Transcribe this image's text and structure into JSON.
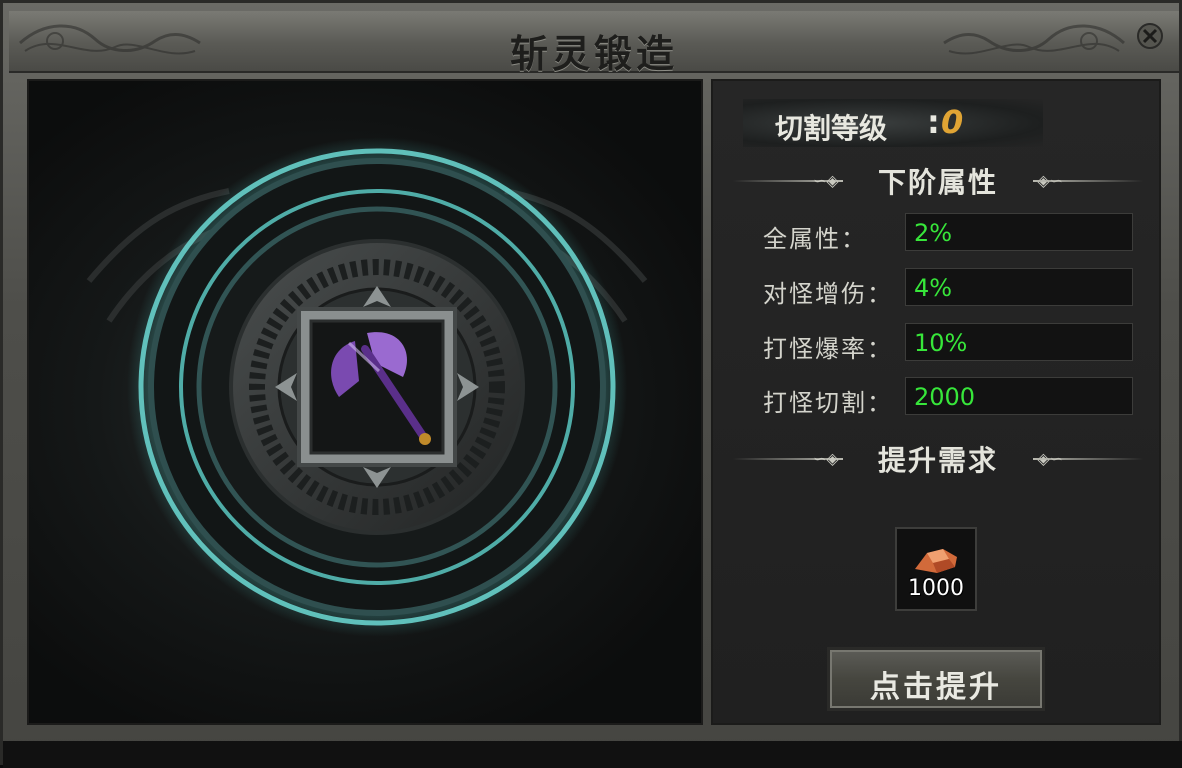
{
  "window": {
    "title": "斩灵锻造"
  },
  "forge": {
    "item_name": "axe"
  },
  "level": {
    "label": "切割等级",
    "separator": ":",
    "value": "0"
  },
  "next_attributes": {
    "heading": "下阶属性",
    "rows": [
      {
        "label": "全属性：",
        "value": "2%"
      },
      {
        "label": "对怪增伤：",
        "value": "4%"
      },
      {
        "label": "打怪爆率：",
        "value": "10%"
      },
      {
        "label": "打怪切割：",
        "value": "2000"
      }
    ]
  },
  "requirements": {
    "heading": "提升需求",
    "item_icon": "ore-icon",
    "item_count": "1000"
  },
  "actions": {
    "upgrade_label": "点击提升"
  },
  "colors": {
    "value_green": "#37e63a",
    "level_gold": "#e0a434",
    "glow_cyan": "#5fe6e0"
  }
}
